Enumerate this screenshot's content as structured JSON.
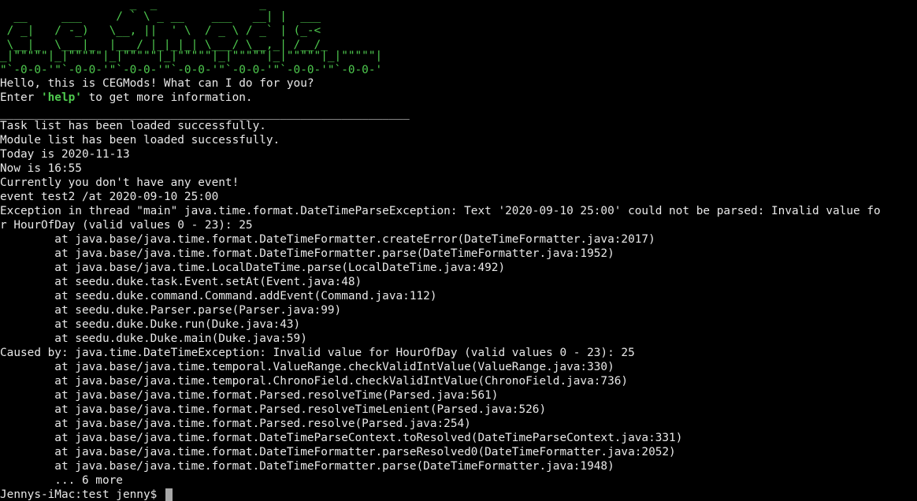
{
  "logo": [
    "                   _  _               _         ",
    "  __     ___     / ` \\ _ __    ___   __| |  ___ ",
    " / _|   / -_)   \\__, ||  ' \\  / _ \\ / _` | (_-< ",
    " \\__|_  \\___|_  |___/ |_|_|_| \\___/ \\__,_| /__/_",
    "_|\"\"\"\"\"|_|\"\"\"\"\"|_|\"\"\"\"\"|_|\"\"\"\"\"|_|\"\"\"\"\"|_|\"\"\"\"\"|_|\"\"\"\"\"|",
    "\"`-0-0-'\"`-0-0-'\"`-0-0-'\"`-0-0-'\"`-0-0-'\"`-0-0-'\"`-0-0-'"
  ],
  "greeting": "Hello, this is CEGMods! What can I do for you?",
  "help_prefix": "Enter ",
  "help_keyword": "'help'",
  "help_suffix": " to get more information.",
  "separator": "____________________________________________________________",
  "output_lines": [
    "Task list has been loaded successfully.",
    "Module list has been loaded successfully.",
    "Today is 2020-11-13",
    "Now is 16:55",
    "Currently you don't have any event!",
    "event test2 /at 2020-09-10 25:00",
    "Exception in thread \"main\" java.time.format.DateTimeParseException: Text '2020-09-10 25:00' could not be parsed: Invalid value fo",
    "r HourOfDay (valid values 0 - 23): 25",
    "        at java.base/java.time.format.DateTimeFormatter.createError(DateTimeFormatter.java:2017)",
    "        at java.base/java.time.format.DateTimeFormatter.parse(DateTimeFormatter.java:1952)",
    "        at java.base/java.time.LocalDateTime.parse(LocalDateTime.java:492)",
    "        at seedu.duke.task.Event.setAt(Event.java:48)",
    "        at seedu.duke.command.Command.addEvent(Command.java:112)",
    "        at seedu.duke.Parser.parse(Parser.java:99)",
    "        at seedu.duke.Duke.run(Duke.java:43)",
    "        at seedu.duke.Duke.main(Duke.java:59)",
    "Caused by: java.time.DateTimeException: Invalid value for HourOfDay (valid values 0 - 23): 25",
    "        at java.base/java.time.temporal.ValueRange.checkValidIntValue(ValueRange.java:330)",
    "        at java.base/java.time.temporal.ChronoField.checkValidIntValue(ChronoField.java:736)",
    "        at java.base/java.time.format.Parsed.resolveTime(Parsed.java:561)",
    "        at java.base/java.time.format.Parsed.resolveTimeLenient(Parsed.java:526)",
    "        at java.base/java.time.format.Parsed.resolve(Parsed.java:254)",
    "        at java.base/java.time.format.DateTimeParseContext.toResolved(DateTimeParseContext.java:331)",
    "        at java.base/java.time.format.DateTimeFormatter.parseResolved0(DateTimeFormatter.java:2052)",
    "        at java.base/java.time.format.DateTimeFormatter.parse(DateTimeFormatter.java:1948)",
    "        ... 6 more"
  ],
  "prompt": "Jennys-iMac:test jenny$ ",
  "colors": {
    "background": "#000000",
    "text": "#e8e8e8",
    "accent_green": "#4ec94e",
    "cursor": "#a8a8a8"
  }
}
